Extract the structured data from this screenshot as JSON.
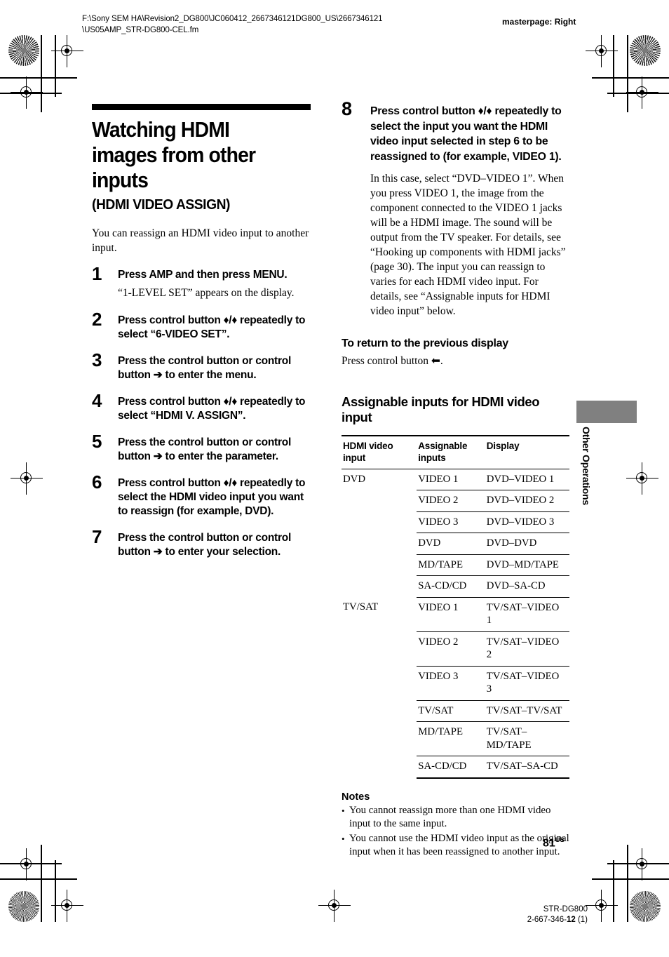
{
  "header": {
    "file_path": "F:\\Sony SEM HA\\Revision2_DG800\\JC060412_2667346121DG800_US\\2667346121\\US05AMP_STR-DG800-CEL.fm",
    "masterpage": "masterpage: Right"
  },
  "left_column": {
    "title": "Watching HDMI images from other inputs",
    "subtitle": "(HDMI VIDEO ASSIGN)",
    "intro": "You can reassign an HDMI video input to another input.",
    "steps": [
      {
        "number": "1",
        "instruction": "Press AMP and then press MENU.",
        "note": "“1-LEVEL SET” appears on the display."
      },
      {
        "number": "2",
        "instruction": "Press control button ♦/♦ repeatedly to select “6-VIDEO SET”.",
        "note": ""
      },
      {
        "number": "3",
        "instruction": "Press the control button or control button ➔ to enter the menu.",
        "note": ""
      },
      {
        "number": "4",
        "instruction": "Press control button ♦/♦ repeatedly to select “HDMI V. ASSIGN”.",
        "note": ""
      },
      {
        "number": "5",
        "instruction": "Press the control button or control button ➔ to enter the parameter.",
        "note": ""
      },
      {
        "number": "6",
        "instruction": "Press control button ♦/♦ repeatedly to select the HDMI video input you want to reassign (for example, DVD).",
        "note": ""
      },
      {
        "number": "7",
        "instruction": "Press the control button or control button ➔ to enter your selection.",
        "note": ""
      }
    ]
  },
  "right_column": {
    "step8": {
      "number": "8",
      "instruction": "Press control button ♦/♦ repeatedly to select the input you want the HDMI video input selected in step 6 to be reassigned to (for example, VIDEO 1).",
      "note": "In this case, select “DVD–VIDEO 1”. When you press VIDEO 1, the image from the component connected to the VIDEO 1 jacks will be a HDMI image. The sound will be output from the TV speaker. For details, see “Hooking up components with HDMI jacks” (page 30). The input you can reassign to varies for each HDMI video input. For details, see “Assignable inputs for HDMI video input” below."
    },
    "return_section": {
      "heading": "To return to the previous display",
      "body": "Press control button ⬅."
    },
    "assignable_section": {
      "heading": "Assignable inputs for HDMI video input",
      "table": {
        "columns": [
          "HDMI video input",
          "Assignable inputs",
          "Display"
        ],
        "rows": [
          {
            "group": "DVD",
            "assignable": "VIDEO 1",
            "display": "DVD–VIDEO 1"
          },
          {
            "group": "",
            "assignable": "VIDEO 2",
            "display": "DVD–VIDEO 2"
          },
          {
            "group": "",
            "assignable": "VIDEO 3",
            "display": "DVD–VIDEO 3"
          },
          {
            "group": "",
            "assignable": "DVD",
            "display": "DVD–DVD"
          },
          {
            "group": "",
            "assignable": "MD/TAPE",
            "display": "DVD–MD/TAPE"
          },
          {
            "group": "",
            "assignable": "SA-CD/CD",
            "display": "DVD–SA-CD"
          },
          {
            "group": "TV/SAT",
            "assignable": "VIDEO 1",
            "display": "TV/SAT–VIDEO 1"
          },
          {
            "group": "",
            "assignable": "VIDEO 2",
            "display": "TV/SAT–VIDEO 2"
          },
          {
            "group": "",
            "assignable": "VIDEO 3",
            "display": "TV/SAT–VIDEO 3"
          },
          {
            "group": "",
            "assignable": "TV/SAT",
            "display": "TV/SAT–TV/SAT"
          },
          {
            "group": "",
            "assignable": "MD/TAPE",
            "display": "TV/SAT–MD/TAPE"
          },
          {
            "group": "",
            "assignable": "SA-CD/CD",
            "display": "TV/SAT–SA-CD"
          }
        ]
      }
    },
    "notes": {
      "heading": "Notes",
      "items": [
        "You cannot reassign more than one HDMI video input to the same input.",
        "You cannot use the HDMI video input as the original input when it has been reassigned to another input."
      ]
    }
  },
  "side_tab": {
    "label": "Other Operations"
  },
  "footer": {
    "page_number": "81",
    "page_suffix": "US",
    "model": "STR-DG800",
    "doc_number_prefix": "2-667-346-",
    "doc_number_bold": "12",
    "doc_number_suffix": " (1)"
  }
}
